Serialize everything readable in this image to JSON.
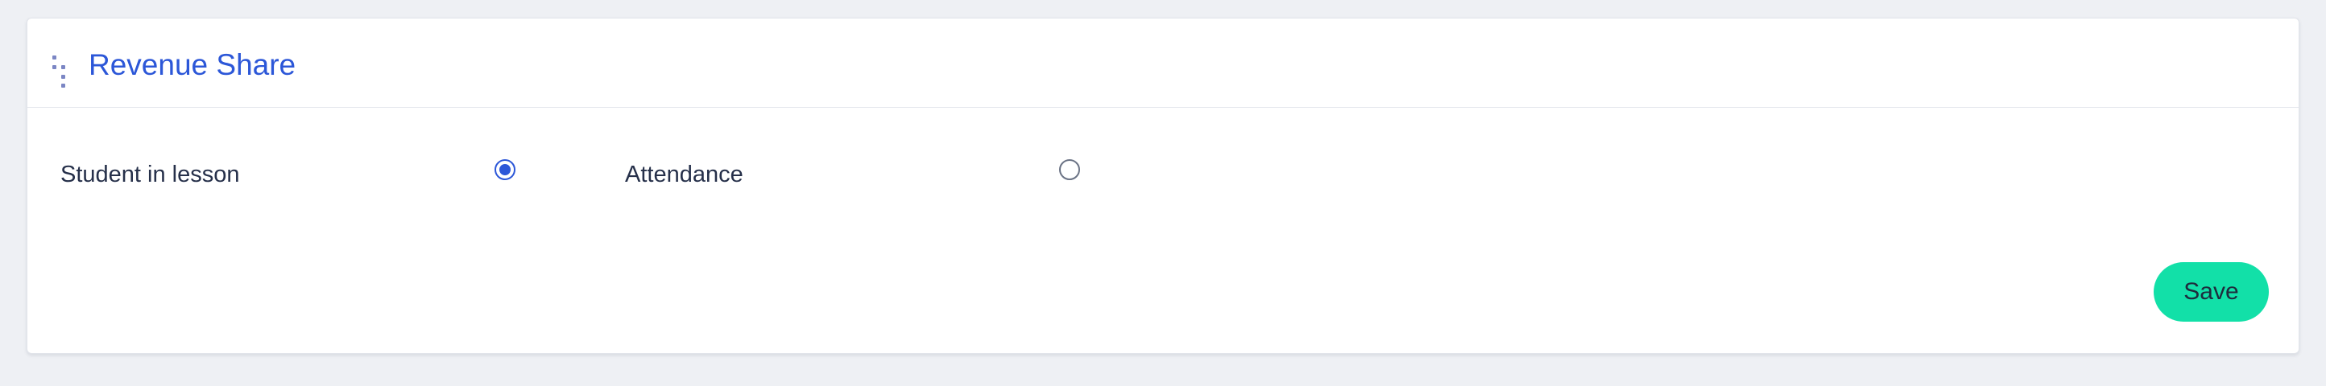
{
  "panel": {
    "title": "Revenue Share",
    "drag_handle_icon": "drag-handle-icon"
  },
  "options": [
    {
      "label": "Student in lesson",
      "selected": true
    },
    {
      "label": "Attendance",
      "selected": false
    }
  ],
  "actions": {
    "save_label": "Save"
  },
  "colors": {
    "accent": "#2c57d8",
    "save_button": "#12e0a8",
    "page_background": "#eef0f4"
  }
}
